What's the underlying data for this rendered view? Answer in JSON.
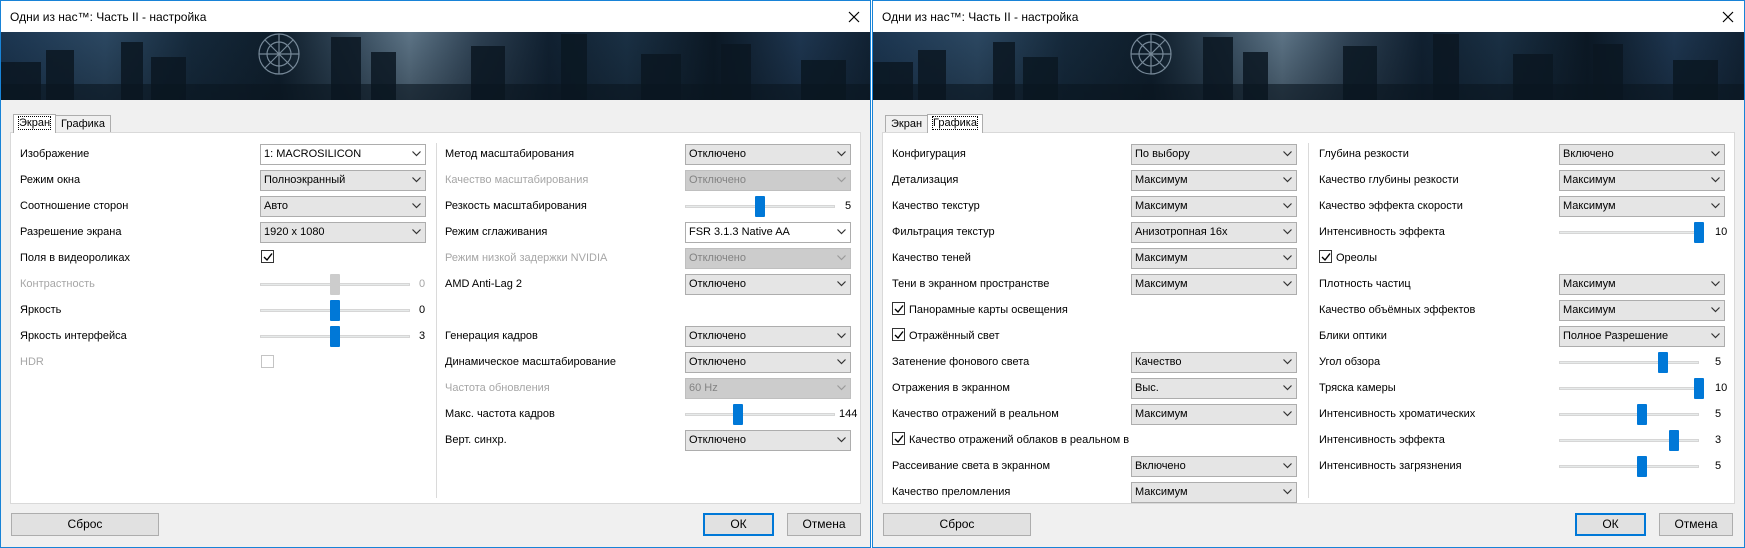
{
  "icons": {
    "close": "close-icon",
    "combo_arrow": "chevron-down-icon",
    "checkmark": "checkmark-icon"
  },
  "colors": {
    "accent": "#0078d7",
    "window_border": "#1883d7",
    "disabled_text": "#a6a6a6"
  },
  "left_window": {
    "title": "Одни из нас™: Часть II - настройка",
    "tabs": [
      {
        "label": "Экран",
        "active": true
      },
      {
        "label": "Графика",
        "active": false
      }
    ],
    "col1": {
      "image": {
        "label": "Изображение",
        "value": "1: MACROSILICON"
      },
      "window_mode": {
        "label": "Режим окна",
        "value": "Полноэкранный"
      },
      "aspect": {
        "label": "Соотношение сторон",
        "value": "Авто"
      },
      "resolution": {
        "label": "Разрешение экрана",
        "value": "1920 x 1080"
      },
      "video_margins": {
        "label": "Поля в видеороликах",
        "checked": true
      },
      "contrast": {
        "label": "Контрастность",
        "value": "0",
        "position": 0.5,
        "disabled": true
      },
      "brightness": {
        "label": "Яркость",
        "value": "0",
        "position": 0.5
      },
      "ui_brightness": {
        "label": "Яркость интерфейса",
        "value": "3",
        "position": 0.5
      },
      "hdr": {
        "label": "HDR",
        "checked": false,
        "disabled": true
      }
    },
    "col2": {
      "scaling_method": {
        "label": "Метод масштабирования",
        "value": "Отключено"
      },
      "scaling_quality": {
        "label": "Качество масштабирования",
        "value": "Отключено",
        "disabled": true
      },
      "scaling_sharpness": {
        "label": "Резкость масштабирования",
        "value": "5",
        "position": 0.5
      },
      "antialiasing": {
        "label": "Режим сглаживания",
        "value": "FSR 3.1.3 Native AA"
      },
      "nvidia_reflex": {
        "label": "Режим низкой задержки NVIDIA",
        "value": "Отключено",
        "disabled": true
      },
      "amd_antilag": {
        "label": "AMD Anti-Lag 2",
        "value": "Отключено"
      },
      "frame_gen": {
        "label": "Генерация кадров",
        "value": "Отключено"
      },
      "dynamic_scaling": {
        "label": "Динамическое масштабирование",
        "value": "Отключено"
      },
      "refresh_rate": {
        "label": "Частота обновления",
        "value": "60 Hz",
        "disabled": true
      },
      "max_fps": {
        "label": "Макс. частота кадров",
        "value": "144",
        "position": 0.35
      },
      "vsync": {
        "label": "Верт. синхр.",
        "value": "Отключено"
      }
    },
    "buttons": {
      "reset": "Сброс",
      "ok": "ОК",
      "cancel": "Отмена"
    }
  },
  "right_window": {
    "title": "Одни из нас™: Часть II - настройка",
    "tabs": [
      {
        "label": "Экран",
        "active": false
      },
      {
        "label": "Графика",
        "active": true
      }
    ],
    "col1": {
      "config": {
        "label": "Конфигурация",
        "value": "По выбору"
      },
      "detail": {
        "label": "Детализация",
        "value": "Максимум"
      },
      "texture_quality": {
        "label": "Качество текстур",
        "value": "Максимум"
      },
      "texture_filtering": {
        "label": "Фильтрация текстур",
        "value": "Анизотропная 16x"
      },
      "shadow_quality": {
        "label": "Качество теней",
        "value": "Максимум"
      },
      "ss_shadows": {
        "label": "Тени в экранном пространстве",
        "value": "Максимум"
      },
      "panoramic_maps": {
        "label": "Панорамные карты освещения",
        "checked": true
      },
      "reflected_light": {
        "label": "Отражённый свет",
        "checked": true
      },
      "ambient_occlusion": {
        "label": "Затенение фонового света",
        "value": "Качество"
      },
      "ss_reflections": {
        "label": "Отражения в экранном",
        "value": "Выс."
      },
      "rt_reflection_quality": {
        "label": "Качество отражений в реальном",
        "value": "Максимум"
      },
      "cloud_reflection": {
        "label": "Качество отражений облаков в реальном в",
        "checked": true
      },
      "ss_scattering": {
        "label": "Рассеивание света в экранном",
        "value": "Включено"
      },
      "refraction": {
        "label": "Качество преломления",
        "value": "Максимум"
      }
    },
    "col2": {
      "dof": {
        "label": "Глубина резкости",
        "value": "Включено"
      },
      "dof_quality": {
        "label": "Качество глубины резкости",
        "value": "Максимум"
      },
      "motion_blur_quality": {
        "label": "Качество эффекта скорости",
        "value": "Максимум"
      },
      "effect_intensity": {
        "label": "Интенсивность эффекта",
        "value": "10",
        "position": 1.0
      },
      "halos": {
        "label": "Ореолы",
        "checked": true
      },
      "particle_density": {
        "label": "Плотность частиц",
        "value": "Максимум"
      },
      "volumetric_quality": {
        "label": "Качество объёмных эффектов",
        "value": "Максимум"
      },
      "lens_flares": {
        "label": "Блики оптики",
        "value": "Полное Разрешение"
      },
      "fov": {
        "label": "Угол обзора",
        "value": "5",
        "position": 0.74
      },
      "camera_shake": {
        "label": "Тряска камеры",
        "value": "10",
        "position": 1.0
      },
      "chromatic_intensity": {
        "label": "Интенсивность хроматических",
        "value": "5",
        "position": 0.59
      },
      "effect_intensity_2": {
        "label": "Интенсивность эффекта",
        "value": "3",
        "position": 0.82
      },
      "grain_intensity": {
        "label": "Интенсивность загрязнения",
        "value": "5",
        "position": 0.59
      }
    },
    "buttons": {
      "reset": "Сброс",
      "ok": "ОК",
      "cancel": "Отмена"
    }
  }
}
